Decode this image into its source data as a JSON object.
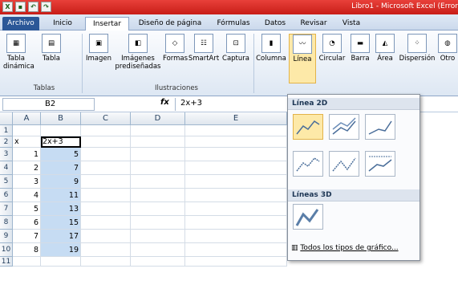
{
  "titlebar": {
    "title": "Libro1 - Microsoft Excel (Error"
  },
  "tabs": [
    "Archivo",
    "Inicio",
    "Insertar",
    "Diseño de página",
    "Fórmulas",
    "Datos",
    "Revisar",
    "Vista"
  ],
  "ribbon": {
    "buttons": [
      "Tabla dinámica",
      "Tabla",
      "Imagen",
      "Imágenes prediseñadas",
      "Formas",
      "SmartArt",
      "Captura",
      "Columna",
      "Línea",
      "Circular",
      "Barra",
      "Área",
      "Dispersión",
      "Otro"
    ],
    "groups": [
      "Tablas",
      "Ilustraciones"
    ]
  },
  "formula_bar": {
    "cell_ref": "B2",
    "fx": "fx",
    "formula": "2x+3"
  },
  "sheet": {
    "columns": [
      "A",
      "B",
      "C",
      "D",
      "E"
    ],
    "rows": [
      "1",
      "2",
      "3",
      "4",
      "5",
      "6",
      "7",
      "8",
      "9",
      "10",
      "11"
    ],
    "a_values": [
      "",
      "x",
      "1",
      "2",
      "3",
      "4",
      "5",
      "6",
      "7",
      "8",
      ""
    ],
    "b_values": [
      "",
      "2x+3",
      "5",
      "7",
      "9",
      "11",
      "13",
      "15",
      "17",
      "19",
      ""
    ]
  },
  "dropdown": {
    "section_2d": "Línea 2D",
    "section_3d": "Líneas 3D",
    "all_types": "Todos los tipos de gráfico..."
  },
  "colors": {
    "title": "#c81d17",
    "file_tab": "#2b5797",
    "selection": "#c6dcf3"
  }
}
